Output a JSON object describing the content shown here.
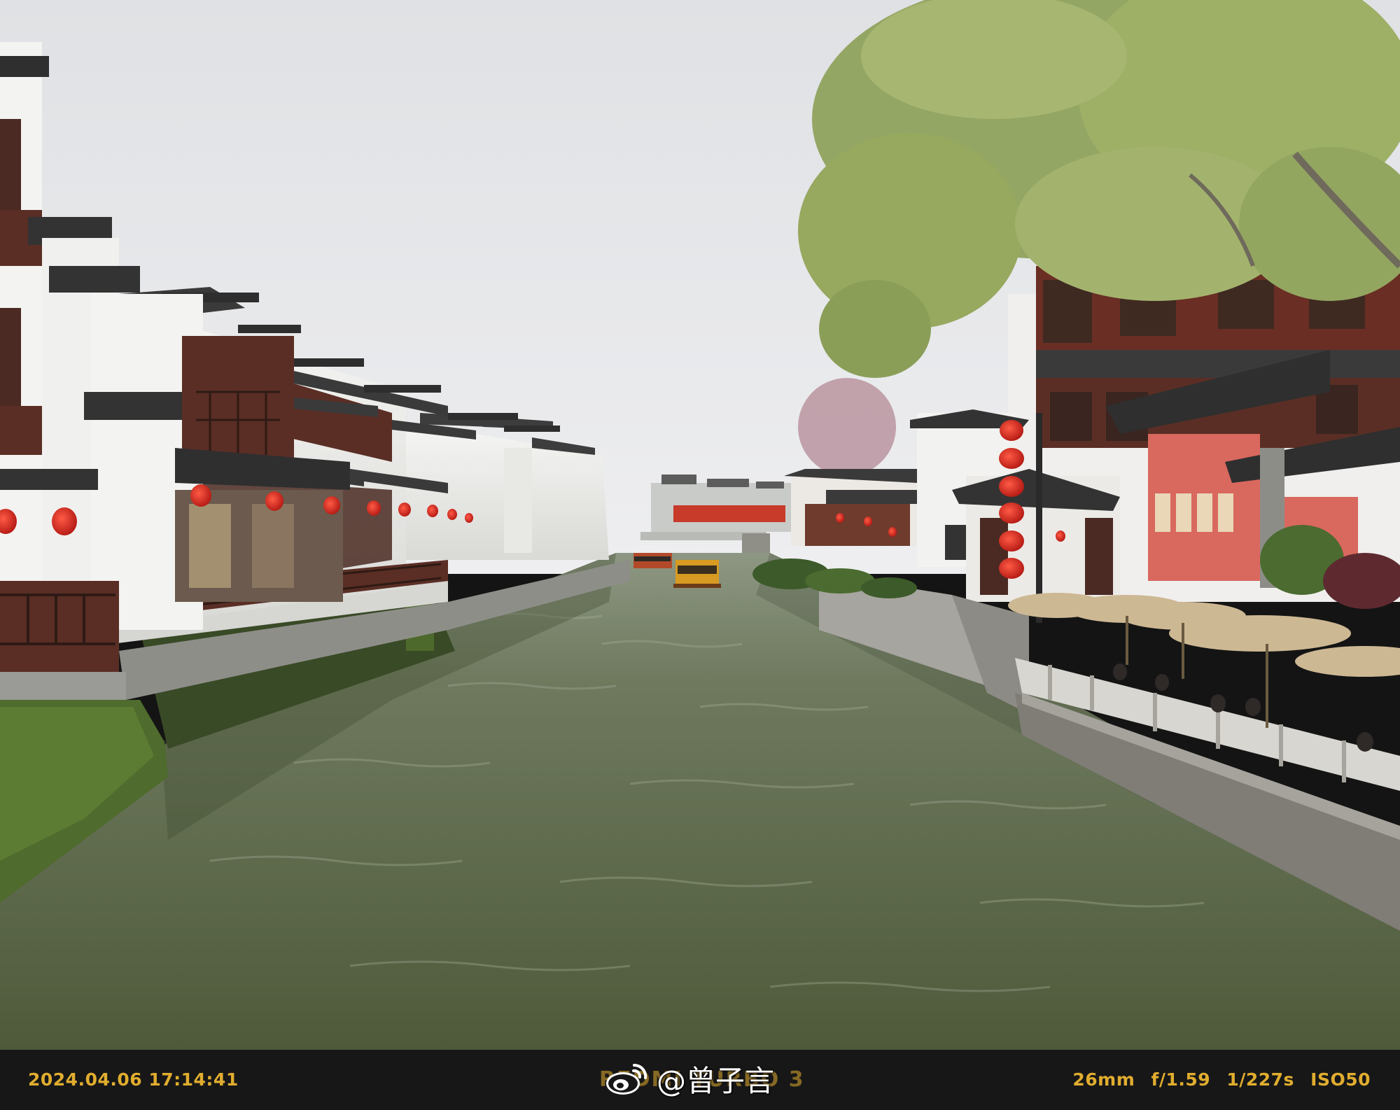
{
  "photo": {
    "description_icon": "canal-scene-photo",
    "colors": {
      "sky": "#e6e7e9",
      "water": "#5f6b4c",
      "roof_tile": "#3a3a3a",
      "white_wall": "#f2f2f0",
      "wood": "#5a2e25",
      "lantern": "#d42b22",
      "foliage": "#8ea35c",
      "red_wall": "#d9685e",
      "umbrella": "#cdb894"
    }
  },
  "info_bar": {
    "timestamp": "2024.04.06 17:14:41",
    "camera_model": "REDMI TURBO 3",
    "exif": "26mm f/1.59 1/227s ISO50",
    "text_color": "#e1ad2f",
    "background": "#171717"
  },
  "watermark": {
    "logo_icon": "weibo-icon",
    "text": "@曾子言"
  }
}
